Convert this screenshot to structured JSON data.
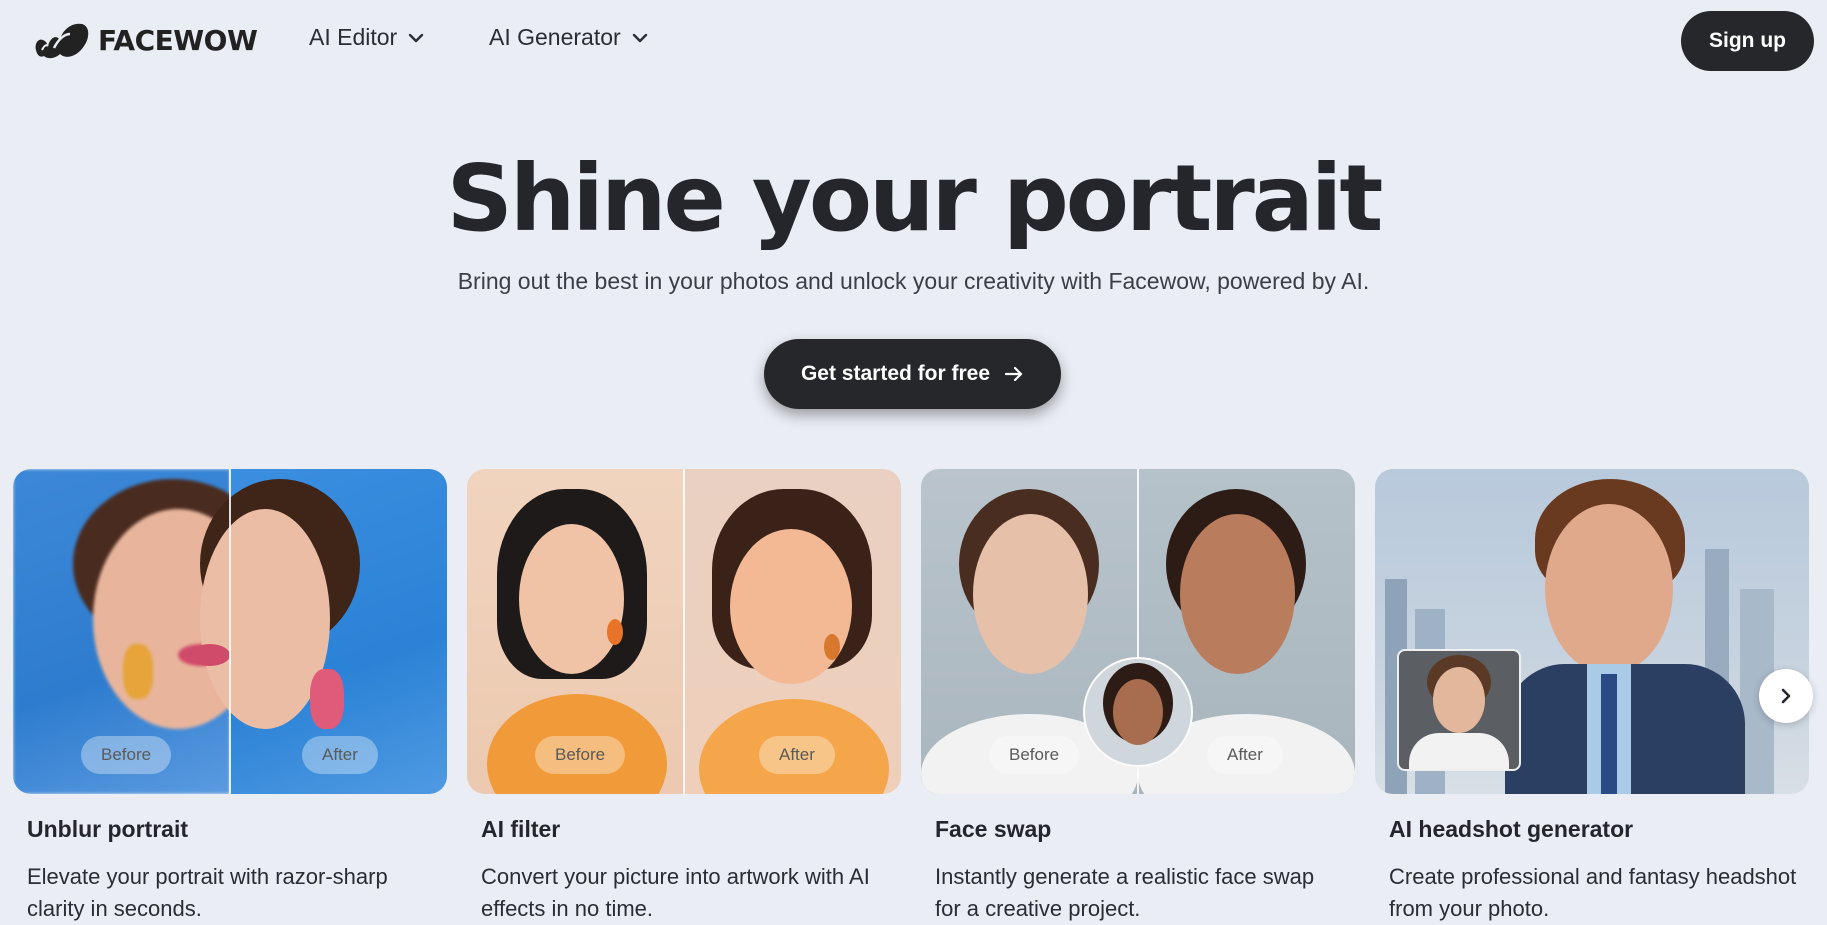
{
  "brand": {
    "name": "FACEWOW"
  },
  "nav": {
    "menus": [
      {
        "label": "AI Editor"
      },
      {
        "label": "AI Generator"
      }
    ],
    "signup_label": "Sign up"
  },
  "hero": {
    "title": "Shine your portrait",
    "subtitle": "Bring out the best in your photos and unlock your creativity with Facewow, powered by AI.",
    "cta_label": "Get started for free"
  },
  "cards": [
    {
      "title": "Unblur portrait",
      "description": "Elevate your portrait with razor-sharp clarity in seconds.",
      "before_label": "Before",
      "after_label": "After"
    },
    {
      "title": "AI filter",
      "description": "Convert your picture into artwork with AI effects in no time.",
      "before_label": "Before",
      "after_label": "After"
    },
    {
      "title": "Face swap",
      "description": "Instantly generate a realistic face swap for a creative project.",
      "before_label": "Before",
      "after_label": "After"
    },
    {
      "title": "AI headshot generator",
      "description": "Create professional and fantasy headshot from your photo."
    }
  ],
  "icons": {
    "logo": "facewow-logo-icon",
    "dropdown": "chevron-down-icon",
    "cta": "arrow-right-icon",
    "carousel": "chevron-right-icon"
  },
  "colors": {
    "background": "#eaedf4",
    "primary_button": "#25272b",
    "text": "#24262b"
  }
}
